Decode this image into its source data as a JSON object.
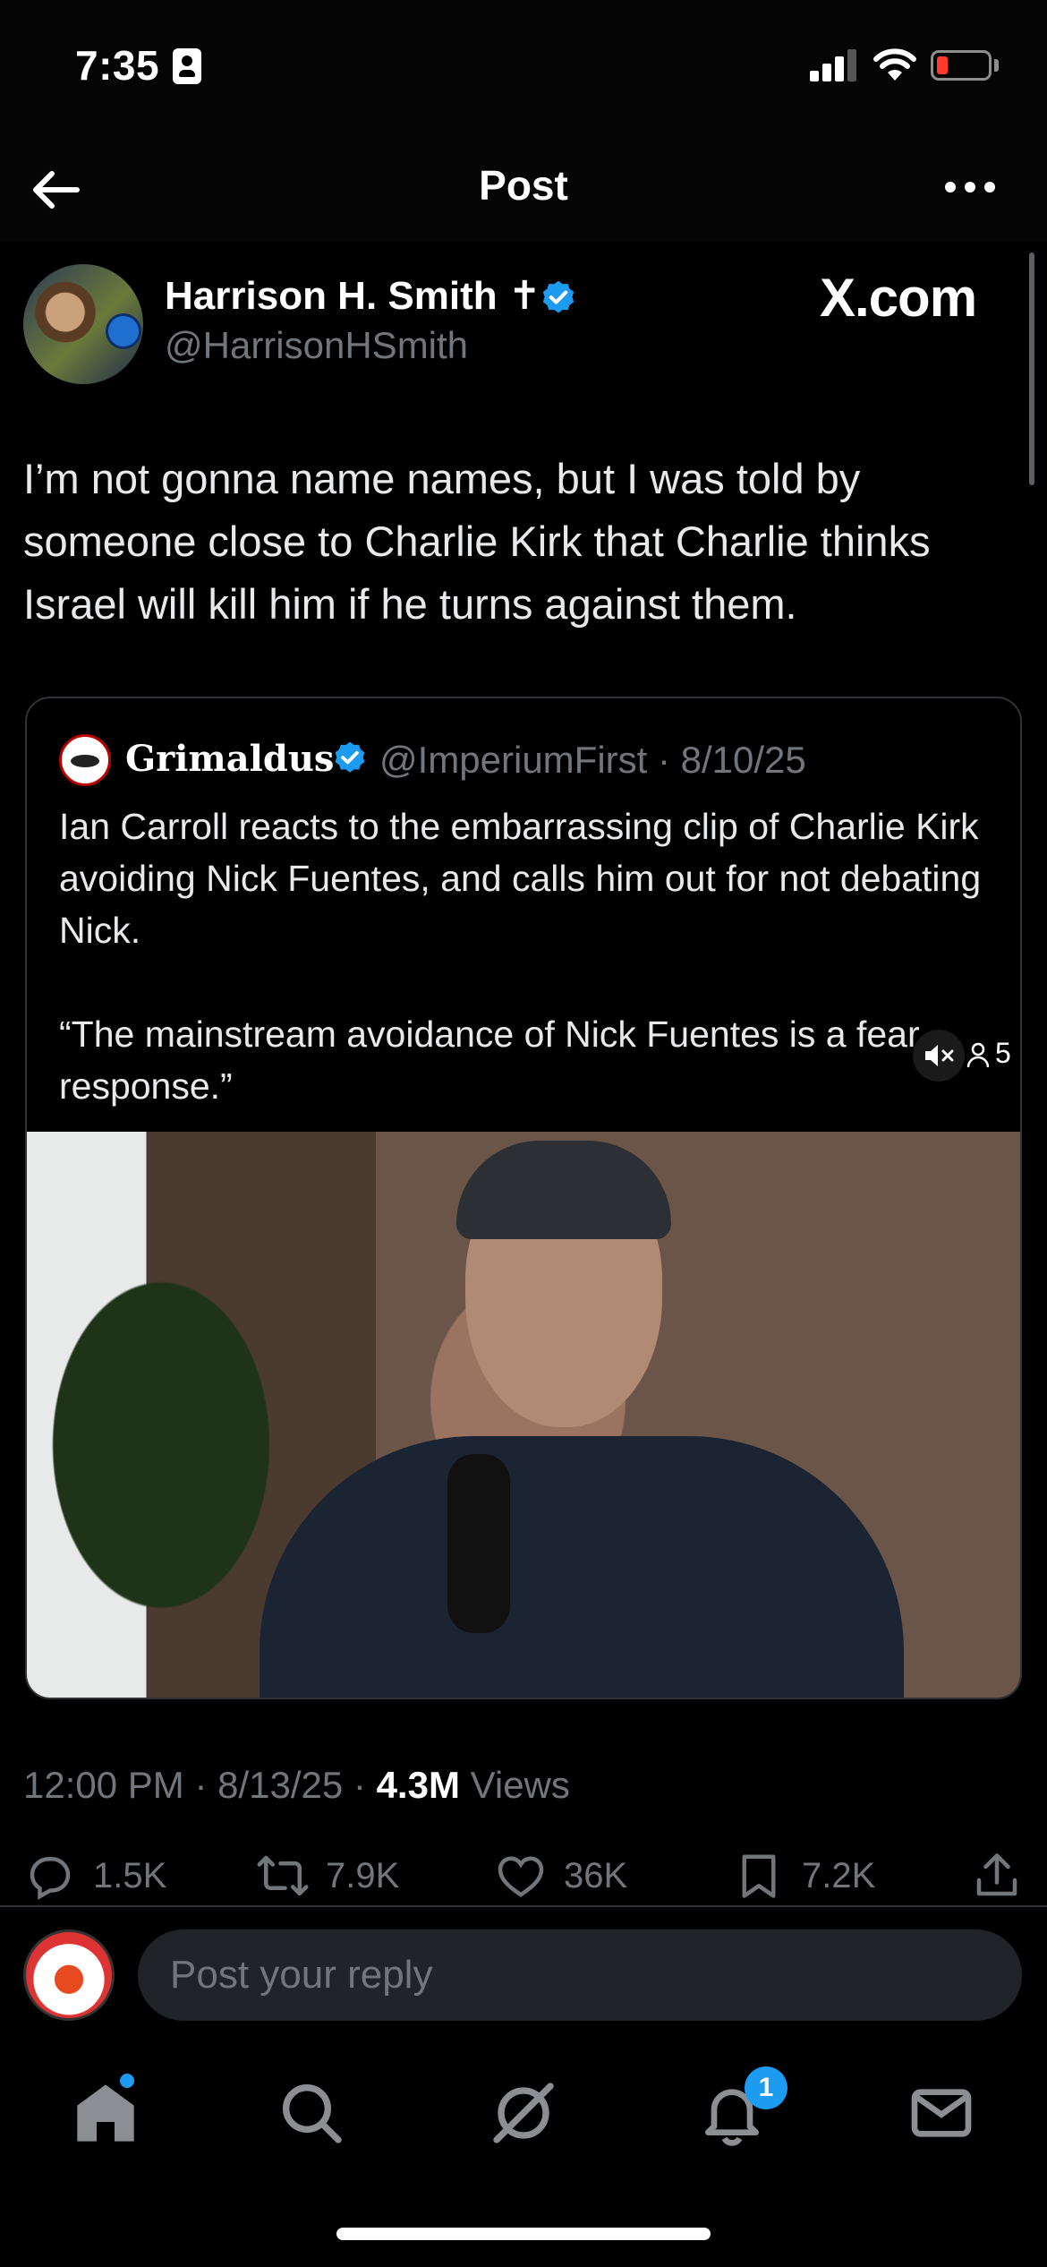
{
  "status_bar": {
    "time": "7:35"
  },
  "header": {
    "title": "Post"
  },
  "post": {
    "author_name": "Harrison H. Smith ✝",
    "author_handle": "@HarrisonHSmith",
    "watermark": "X.com",
    "text": "I’m not gonna name names, but I was told by someone close to Charlie Kirk that Charlie thinks Israel will kill him if he turns against them.",
    "timestamp": "12:00 PM · 8/13/25 · ",
    "views_count": "4.3M",
    "views_label": " Views"
  },
  "quote": {
    "name": "Grimaldus",
    "meta": "@ImperiumFirst · 8/10/25",
    "text": "Ian Carroll reacts to the embarrassing clip of Charlie Kirk avoiding Nick Fuentes, and calls him out for not debating Nick.\n\n“The mainstream avoidance of Nick Fuentes is a fear response.”",
    "media_counter": "5"
  },
  "actions": {
    "replies": "1.5K",
    "reposts": "7.9K",
    "likes": "36K",
    "bookmarks": "7.2K"
  },
  "reply": {
    "placeholder": "Post your reply"
  },
  "nav": {
    "notifications_badge": "1"
  },
  "colors": {
    "accent": "#1d9bf0",
    "background": "#000000",
    "muted_text": "#71767b",
    "border": "#2f3336"
  }
}
